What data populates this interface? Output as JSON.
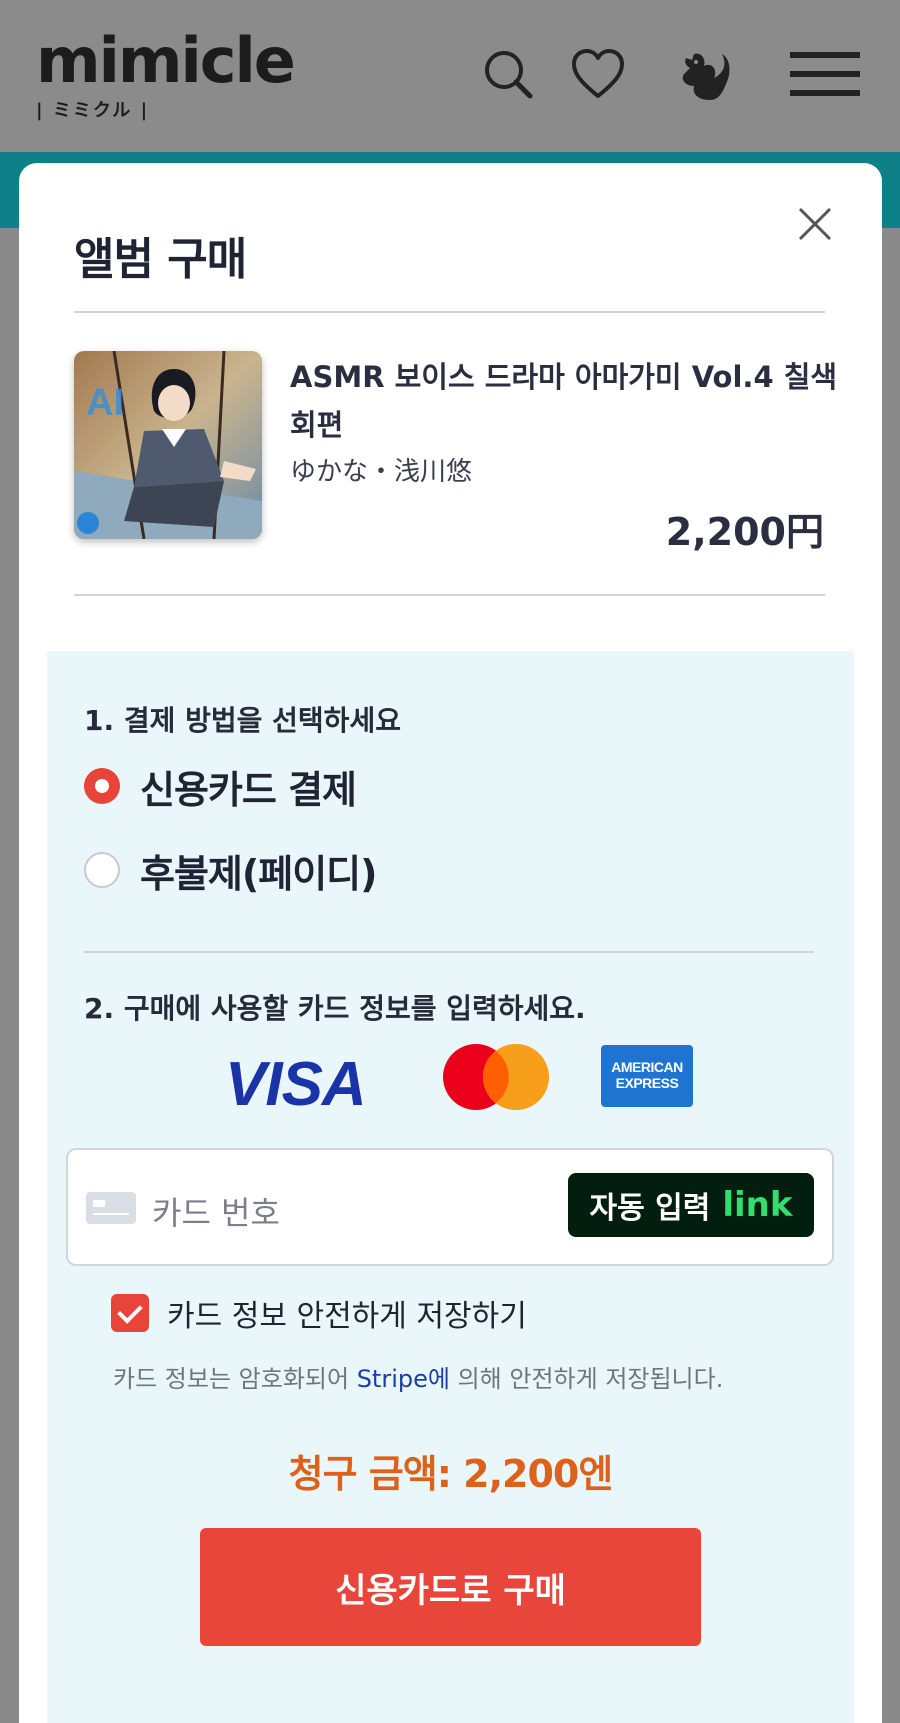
{
  "header": {
    "logo_text": "mimicle",
    "logo_sub": "| ミミクル |"
  },
  "modal": {
    "title": "앨범 구매",
    "album": {
      "title": "ASMR 보이스 드라마 아마가미 Vol.4 칠색 회편",
      "artist": "ゆかな・浅川悠",
      "price": "2,200円",
      "art_badge": "AI"
    },
    "step1": {
      "label": "1. 결제 방법을 선택하세요",
      "options": [
        {
          "label": "신용카드 결제",
          "selected": true
        },
        {
          "label": "후불제(페이디)",
          "selected": false
        }
      ]
    },
    "step2": {
      "label": "2. 구매에 사용할 카드 정보를 입력하세요.",
      "card_brands": {
        "visa": "VISA",
        "amex_line1": "AMERICAN",
        "amex_line2": "EXPRESS"
      },
      "card_placeholder": "카드 번호",
      "autofill_label": "자동 입력",
      "autofill_brand": "link",
      "save_card_label": "카드 정보 안전하게 저장하기",
      "save_card_checked": true,
      "note_before": "카드 정보는 암호화되어 ",
      "note_link": "Stripe에",
      "note_after": " 의해 안전하게 저장됩니다."
    },
    "total": "청구 금액: 2,200엔",
    "buy_button": "신용카드로 구매"
  },
  "colors": {
    "accent_red": "#e8443a",
    "total_orange": "#dd6118",
    "teal": "#0e8188",
    "pay_box_bg": "#eaf7fa"
  }
}
